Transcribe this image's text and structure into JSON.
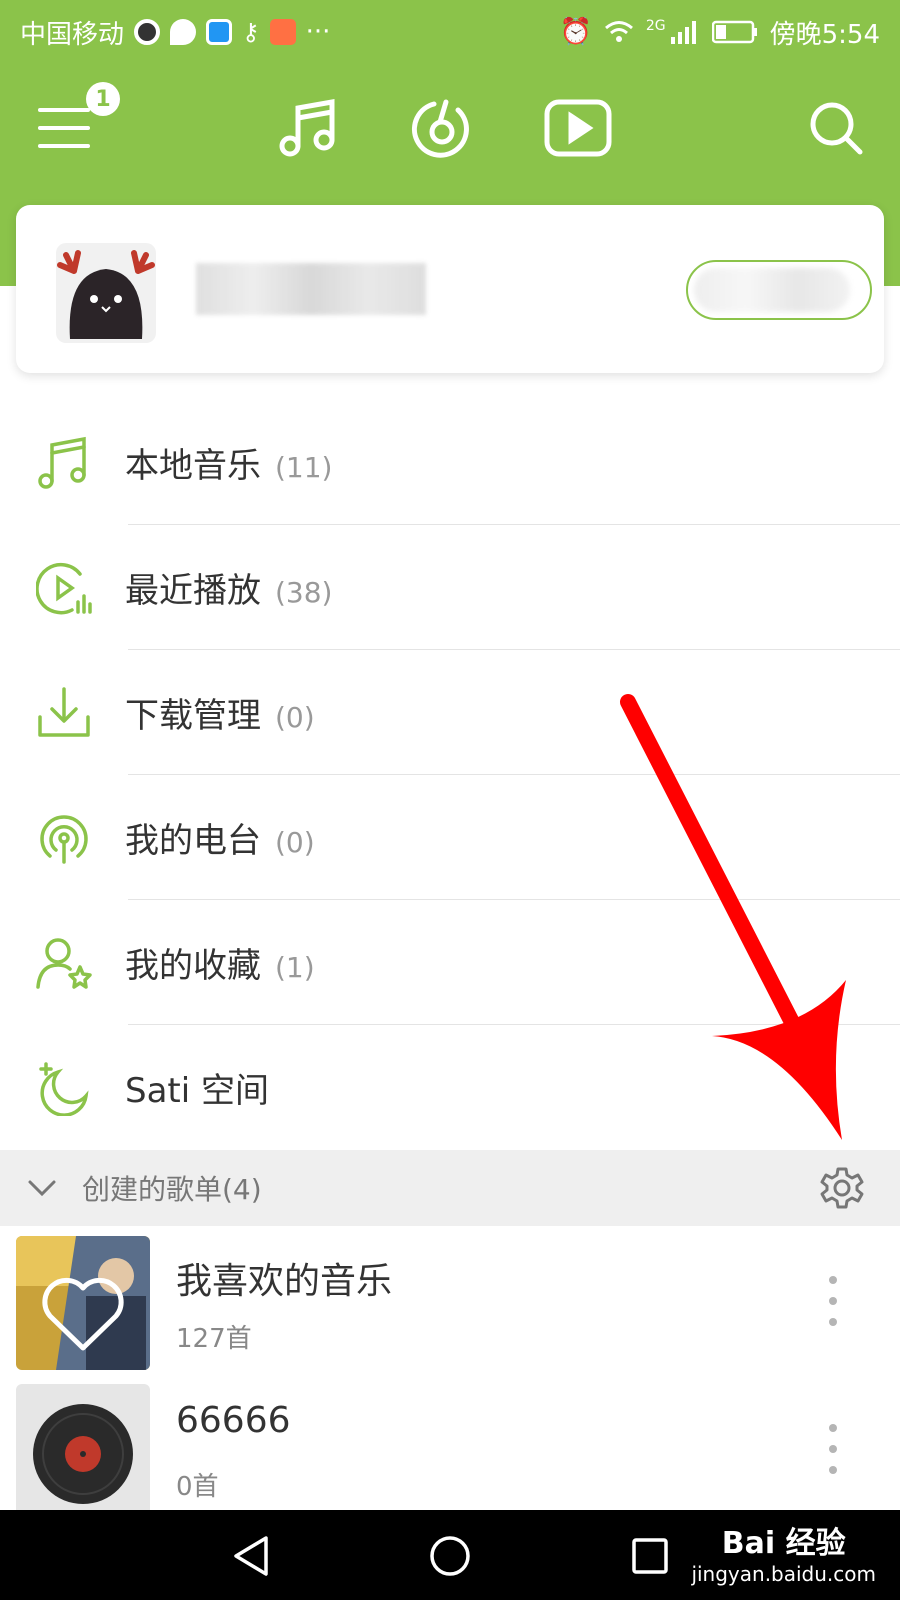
{
  "status_bar": {
    "carrier": "中国移动",
    "network": "2G",
    "time": "傍晚5:54",
    "more": "···"
  },
  "header": {
    "menu_badge": "1",
    "tabs": [
      "music-note-icon",
      "radar-icon",
      "video-icon"
    ]
  },
  "profile": {
    "name": "",
    "action": ""
  },
  "menu": [
    {
      "label": "本地音乐",
      "count": "(11)",
      "icon": "music-note-icon"
    },
    {
      "label": "最近播放",
      "count": "(38)",
      "icon": "recent-play-icon"
    },
    {
      "label": "下载管理",
      "count": "(0)",
      "icon": "download-icon"
    },
    {
      "label": "我的电台",
      "count": "(0)",
      "icon": "radio-icon"
    },
    {
      "label": "我的收藏",
      "count": "(1)",
      "icon": "favorite-user-icon"
    },
    {
      "label": "Sati 空间",
      "count": "",
      "icon": "moon-icon"
    }
  ],
  "playlists_section": {
    "title": "创建的歌单(4)"
  },
  "playlists": [
    {
      "name": "我喜欢的音乐",
      "count": "127首"
    },
    {
      "name": "66666",
      "count": "0首"
    }
  ],
  "watermark": {
    "logo": "Bai  经验",
    "url": "jingyan.baidu.com"
  },
  "colors": {
    "accent": "#8bc34a",
    "arrow": "#ff0000"
  }
}
